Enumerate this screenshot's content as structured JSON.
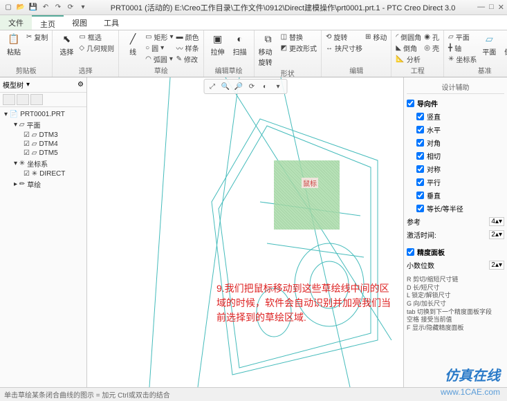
{
  "title": "PRT0001 (活动的) E:\\Creo工作目录\\工作文件\\0912\\Direct建模操作\\prt0001.prt.1 - PTC Creo Direct 3.0",
  "menu": {
    "file": "文件",
    "home": "主页",
    "view": "视图",
    "tools": "工具"
  },
  "ribbon": {
    "clipboard": {
      "label": "剪贴板",
      "copy": "复制",
      "paste": "粘贴"
    },
    "select": {
      "label": "选择",
      "select": "选择",
      "filter": "框选",
      "geom": "几何规则"
    },
    "sketch": {
      "label": "草绘",
      "line": "线",
      "rect": "矩形",
      "circle": "圆",
      "arc": "弧圆",
      "color": "颜色",
      "delete": "样条",
      "modify": "修改"
    },
    "edit_sketch": {
      "label": "编辑草绘",
      "stretch": "拉伸",
      "sweep": "扫描"
    },
    "shape": {
      "label": "形状",
      "move": "移动旋转",
      "scale": "替换",
      "more": "更改形式"
    },
    "edit": {
      "label": "编辑",
      "rotate": "旋转",
      "dim": "挟尺寸移",
      "pattern": "移动",
      "round": "倒圆角",
      "hole": "孔",
      "chamfer": "倒角",
      "analyze": "分析",
      "shell": "壳"
    },
    "eng": {
      "label": "工程"
    },
    "datum": {
      "label": "基准",
      "plane1": "平面",
      "axis": "轴",
      "csys": "坐标系",
      "plane2": "平面",
      "round2": "倒圆"
    }
  },
  "tree": {
    "tab": "模型树",
    "root": "PRT0001.PRT",
    "planes": "平面",
    "dtm3": "DTM3",
    "dtm4": "DTM4",
    "dtm5": "DTM5",
    "csys_grp": "坐标系",
    "direct": "DIRECT",
    "sketch": "草绘"
  },
  "cursor_label": "鼠标",
  "annotation": "9.我们把鼠标移动到这些草绘线中间的区域的时候，软件会自动识别并加亮我们当前选择到的草绘区域.",
  "right": {
    "title": "设计辅助",
    "guide": "导向件",
    "vert": "竖直",
    "horiz": "水平",
    "diag": "对角",
    "tan": "相切",
    "sym": "对称",
    "para": "平行",
    "perp": "垂直",
    "equal": "等长/等半径",
    "ref": "参考",
    "ref_val": "4",
    "delay": "激活时间:",
    "delay_val": "2",
    "panel": "精度面板",
    "decimals": "小数位数",
    "dec_val": "2",
    "help": "R 剪切/缩短尺寸链\nD 长/短尺寸\nL 锁定/解锁尺寸\nG 向/加长尺寸\ntab 切换到下一个精度面板字段\n空格 接受当前值\nF 显示/隐藏精度面板"
  },
  "status": "单击草绘某条闭合曲线的图示 = 加元 Ctrl或双击的结合",
  "watermark": "仿真在线",
  "watermark_url": "www.1CAE.com"
}
